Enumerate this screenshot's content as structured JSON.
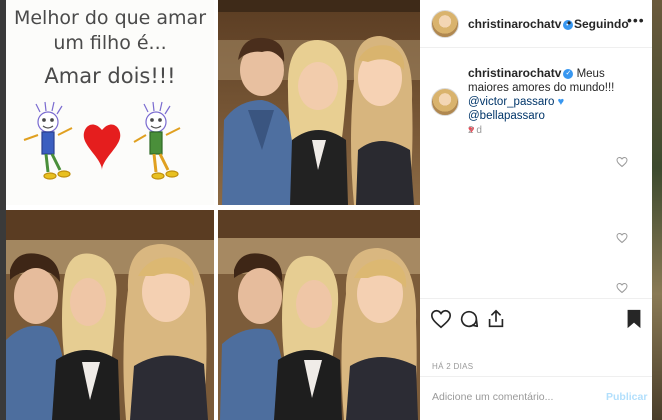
{
  "post": {
    "quote_line1": "Melhor do que amar",
    "quote_line2": "um filho é...",
    "quote_line3": "Amar dois!!!"
  },
  "header": {
    "username": "christinarochatv",
    "separator": "•",
    "follow_status": "Seguindo",
    "more": "•••"
  },
  "caption": {
    "username": "christinarochatv",
    "text": " Meus maiores amores do mundo!!!",
    "mention1": "@victor_passaro",
    "mention2": "@bellapassaro",
    "time": "2 d"
  },
  "footer": {
    "date": "HÁ 2 DIAS",
    "comment_placeholder": "Adicione um comentário...",
    "publish": "Publicar"
  },
  "colors": {
    "accent": "#3897f0",
    "like_red": "#ed4956",
    "publish_disabled": "#b2dffc",
    "mention": "#003569"
  },
  "icons": [
    "verified-badge-icon",
    "more-options-icon",
    "heart-icon",
    "comment-icon",
    "share-icon",
    "bookmark-icon",
    "like-comment-icon"
  ]
}
